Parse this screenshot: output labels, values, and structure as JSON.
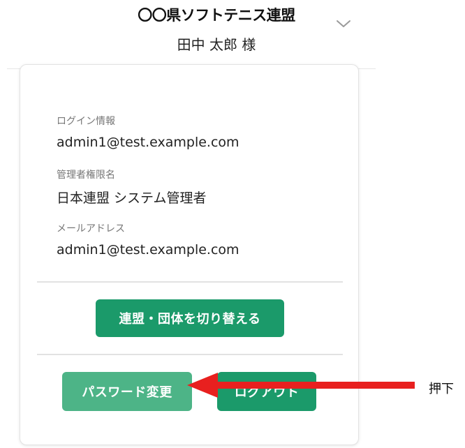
{
  "header": {
    "title": "〇〇県ソフトテニス連盟",
    "user": "田中 太郎 様"
  },
  "account": {
    "login_label": "ログイン情報",
    "login_value": "admin1@test.example.com",
    "role_label": "管理者権限名",
    "role_value": "日本連盟 システム管理者",
    "email_label": "メールアドレス",
    "email_value": "admin1@test.example.com"
  },
  "buttons": {
    "switch_label": "連盟・団体を切り替える",
    "password_label": "パスワード変更",
    "logout_label": "ログアウト"
  },
  "annotation": {
    "press_label": "押下",
    "arrow_color": "#e8201f"
  },
  "colors": {
    "primary": "#1b9a6a",
    "primary_light": "#4db487"
  }
}
